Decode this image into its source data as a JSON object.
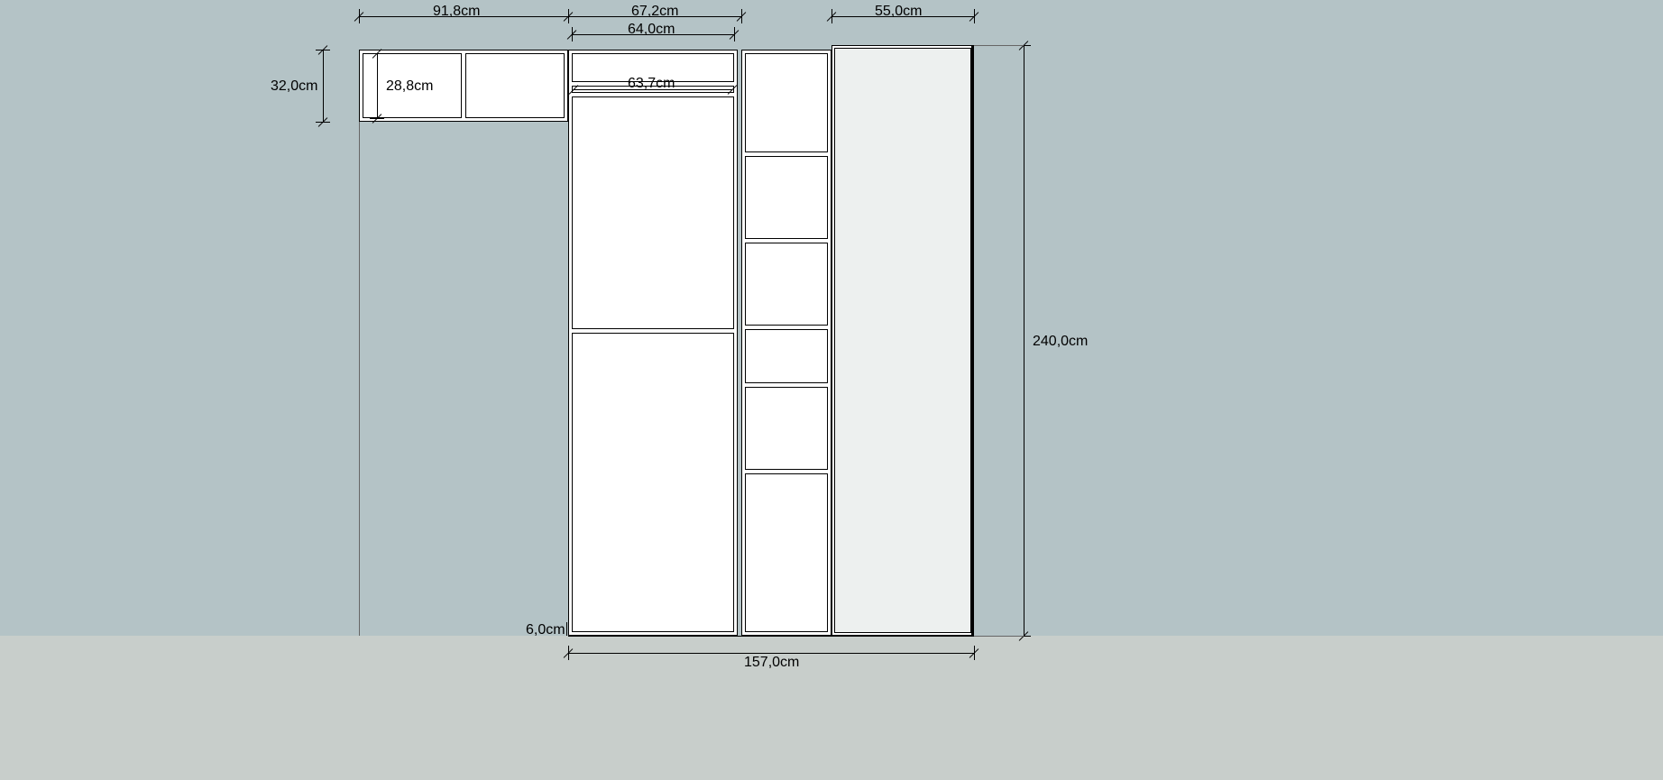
{
  "dimensions": {
    "top_left_width": "91,8cm",
    "top_mid_width": "67,2cm",
    "shelf_inner_width": "64,0cm",
    "rail_width": "63,7cm",
    "top_right_width": "55,0cm",
    "left_outer_height": "32,0cm",
    "left_inner_height": "28,8cm",
    "total_height": "240,0cm",
    "bottom_width": "157,0cm",
    "plinth_height": "6,0cm"
  }
}
